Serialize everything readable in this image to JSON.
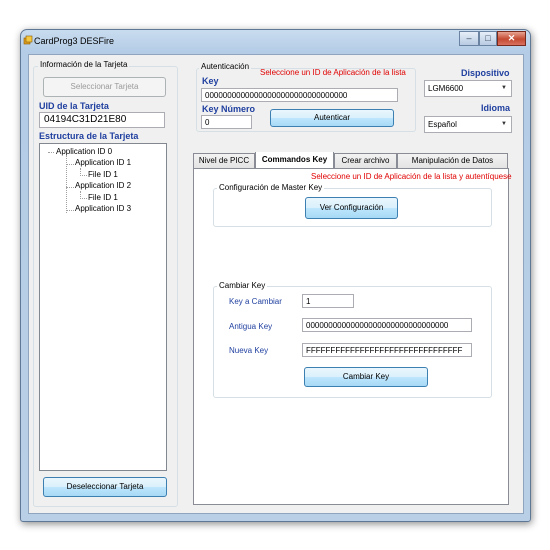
{
  "window": {
    "title": "CardProg3 DESFire",
    "minimize": "‒",
    "maximize": "□",
    "close": "✕"
  },
  "card_info": {
    "group_label": "Información de la Tarjeta",
    "select_button": "Seleccionar Tarjeta",
    "uid_label": "UID de la Tarjeta",
    "uid_value": "04194C31D21E80",
    "structure_label": "Estructura de la Tarjeta",
    "tree": [
      {
        "text": "Application ID 0",
        "level": 0
      },
      {
        "text": "Application ID 1",
        "level": 1
      },
      {
        "text": "File ID 1",
        "level": 2
      },
      {
        "text": "Application ID 2",
        "level": 1
      },
      {
        "text": "File ID 1",
        "level": 2
      },
      {
        "text": "Application ID 3",
        "level": 1
      }
    ],
    "deselect_button": "Deseleccionar Tarjeta"
  },
  "auth": {
    "group_label": "Autenticación",
    "key_label": "Key",
    "warning": "Seleccione un ID de Aplicación de la lista",
    "key_value": "00000000000000000000000000000000",
    "key_number_label": "Key Número",
    "key_number_value": "0",
    "auth_button": "Autenticar"
  },
  "device": {
    "label": "Dispositivo",
    "value": "LGM6600"
  },
  "language": {
    "label": "Idioma",
    "value": "Español"
  },
  "tabs": [
    "Nivel de PICC",
    "Commandos Key",
    "Crear archivo",
    "Manipulación de Datos"
  ],
  "active_tab": 1,
  "commands_key": {
    "warning": "Seleccione un ID de Aplicación de la lista y autentíquese",
    "master_group_label": "Configuración de Master Key",
    "view_config_button": "Ver Configuración",
    "change_group_label": "Cambiar Key",
    "key_to_change_label": "Key a Cambiar",
    "key_to_change_value": "1",
    "old_key_label": "Antigua Key",
    "old_key_value": "00000000000000000000000000000000",
    "new_key_label": "Nueva Key",
    "new_key_value": "FFFFFFFFFFFFFFFFFFFFFFFFFFFFFFFF",
    "change_key_button": "Cambiar Key"
  },
  "colors": {
    "warning": "#e00000",
    "label_blue": "#1f3f9f",
    "window_frame": "#b9cfe6"
  }
}
